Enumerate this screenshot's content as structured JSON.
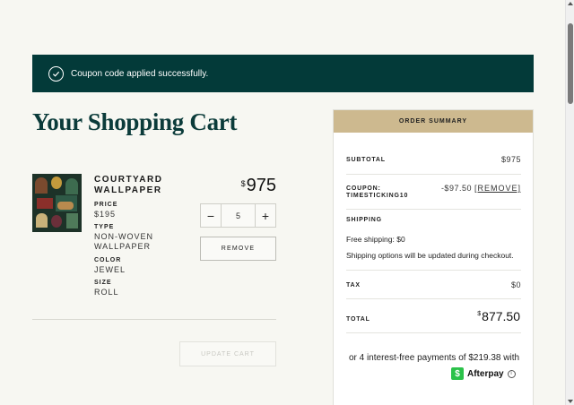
{
  "banner": {
    "message": "Coupon code applied successfully."
  },
  "page": {
    "title": "Your Shopping Cart"
  },
  "item": {
    "name": "COURTYARD WALLPAPER",
    "price_currency": "$",
    "price_amount": "975",
    "attributes": [
      {
        "label": "PRICE",
        "value": "$195"
      },
      {
        "label": "TYPE",
        "value": "NON-WOVEN WALLPAPER"
      },
      {
        "label": "COLOR",
        "value": "JEWEL"
      },
      {
        "label": "SIZE",
        "value": "ROLL"
      }
    ],
    "quantity": "5",
    "minus_label": "−",
    "plus_label": "+",
    "remove_label": "REMOVE"
  },
  "update_cart_label": "UPDATE CART",
  "summary": {
    "header": "ORDER SUMMARY",
    "subtotal_label": "SUBTOTAL",
    "subtotal_value": "$975",
    "coupon_label_1": "COUPON:",
    "coupon_label_2": "TIMESTICKING10",
    "coupon_value": "-$97.50",
    "coupon_remove": "[REMOVE]",
    "shipping_label": "SHIPPING",
    "shipping_free": "Free shipping: $0",
    "shipping_note": "Shipping options will be updated during checkout.",
    "tax_label": "TAX",
    "tax_value": "$0",
    "total_label": "TOTAL",
    "total_currency": "$",
    "total_amount": "877.50",
    "afterpay_text": "or 4 interest-free payments of $219.38 with",
    "afterpay_name": "Afterpay",
    "afterpay_info": "i"
  },
  "colors": {
    "banner_bg": "#033a39",
    "title": "#0b3b3a",
    "summary_header": "#cdb98f",
    "afterpay": "#2bc24a"
  },
  "icons": [
    "check-circle-icon",
    "minus-icon",
    "plus-icon",
    "afterpay-logo-icon",
    "info-icon"
  ]
}
